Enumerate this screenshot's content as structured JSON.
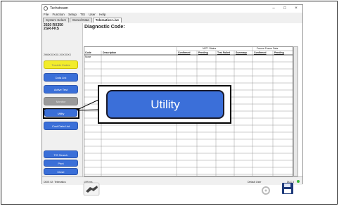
{
  "window": {
    "title": "Techstream",
    "controls": [
      "–",
      "□",
      "×"
    ]
  },
  "menu": [
    "File",
    "Function",
    "Setup",
    "TIS",
    "User",
    "Help"
  ],
  "tabs": [
    "System Select",
    "Stored Data",
    "Telematics Live"
  ],
  "vehicle": {
    "line1": "2020 RX350",
    "line2": "2GR-FKS"
  },
  "vin": "2HMXXXXXX-XXXXXXX",
  "side_buttons": [
    "Trouble Codes",
    "Data List",
    "Active Test",
    "Monitor",
    "Utility",
    "Cust Data List"
  ],
  "bottom_buttons": [
    "TIS Search",
    "Print",
    "Close"
  ],
  "main": {
    "title": "Diagnostic Code:",
    "group_headers": [
      "NST* Status",
      "Freeze Frame Data"
    ],
    "columns": [
      "Code",
      "Description",
      "Confirmed",
      "Pending",
      "Test Failed",
      "Summary",
      "Confirmed",
      "Pending"
    ],
    "first_row": "None"
  },
  "status": {
    "left": "DDIS 02: Telematics",
    "mid": "1/99 ms",
    "user": "Default User",
    "right": "DLC 3"
  },
  "callout": {
    "label": "Utility"
  },
  "colors": {
    "button_blue": "#3a6fd8",
    "highlight_yellow": "#f2ec2c",
    "disabled_gray": "#9a9a9a"
  }
}
